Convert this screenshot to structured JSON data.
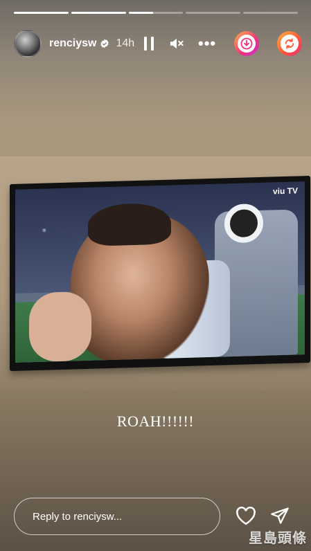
{
  "story": {
    "progress": [
      1,
      1,
      0.45,
      0,
      0
    ],
    "username": "renciysw",
    "time": "14h",
    "caption": "ROAH!!!!!!",
    "reply_placeholder": "Reply to renciysw..."
  },
  "tv_logo": "viu TV",
  "watermark": "星島頭條",
  "colors": {
    "story_gradient_top": "#6f6a64",
    "story_gradient_bottom": "#5c5145",
    "accent_pink": "#f0317c",
    "accent_orange": "#ff5a36"
  },
  "icons": {
    "verified": "verified-badge-icon",
    "pause": "pause-icon",
    "mute": "mute-icon",
    "more": "more-icon",
    "save": "download-icon",
    "remix": "remix-icon",
    "like": "heart-icon",
    "share": "send-icon"
  }
}
